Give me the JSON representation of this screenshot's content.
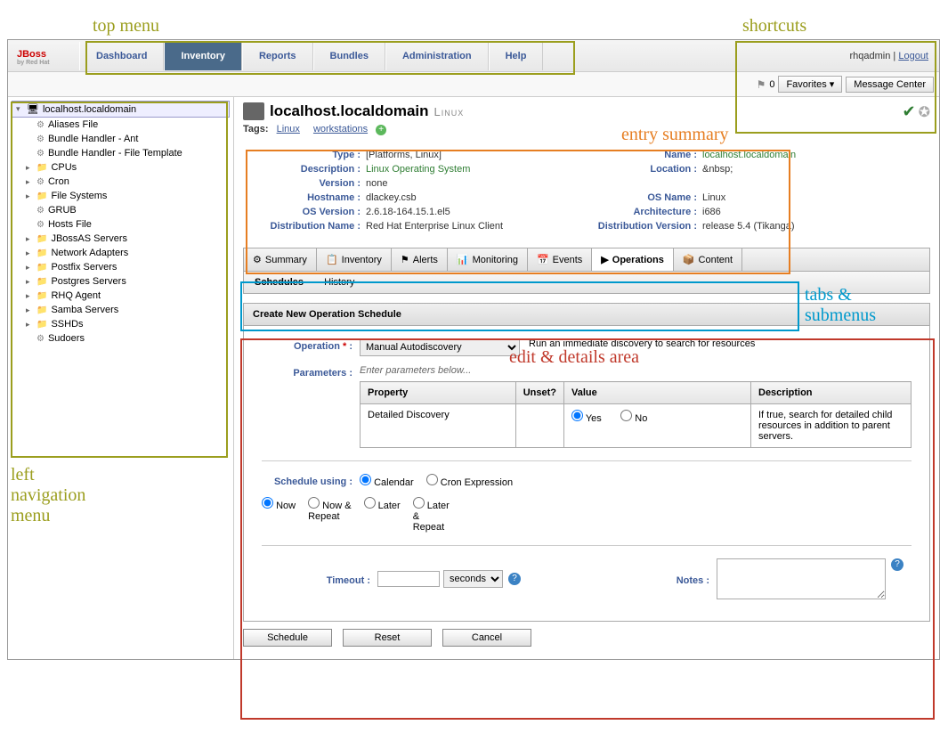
{
  "annotations": {
    "topmenu": "top menu",
    "shortcuts": "shortcuts",
    "leftnav": "left\nnavigation\nmenu",
    "entry": "entry summary",
    "tabs": "tabs &\nsubmenus",
    "edit": "edit & details area"
  },
  "logo": {
    "name": "JBoss",
    "sub": "by Red Hat"
  },
  "topmenu": [
    {
      "label": "Dashboard"
    },
    {
      "label": "Inventory",
      "active": true
    },
    {
      "label": "Reports"
    },
    {
      "label": "Bundles"
    },
    {
      "label": "Administration"
    },
    {
      "label": "Help"
    }
  ],
  "user": {
    "name": "rhqadmin",
    "logout": "Logout"
  },
  "shortcuts": {
    "flagcount": "0",
    "favorites": "Favorites",
    "msgcenter": "Message Center"
  },
  "tree": {
    "root": "localhost.localdomain",
    "items": [
      {
        "icon": "gear",
        "label": "Aliases File"
      },
      {
        "icon": "gear",
        "label": "Bundle Handler - Ant"
      },
      {
        "icon": "gear",
        "label": "Bundle Handler - File Template"
      },
      {
        "icon": "folder",
        "label": "CPUs",
        "expandable": true
      },
      {
        "icon": "gear",
        "label": "Cron",
        "expandable": true
      },
      {
        "icon": "folder",
        "label": "File Systems",
        "expandable": true
      },
      {
        "icon": "gear",
        "label": "GRUB"
      },
      {
        "icon": "gear",
        "label": "Hosts File"
      },
      {
        "icon": "folder",
        "label": "JBossAS Servers",
        "expandable": true
      },
      {
        "icon": "folder",
        "label": "Network Adapters",
        "expandable": true
      },
      {
        "icon": "folder",
        "label": "Postfix Servers",
        "expandable": true
      },
      {
        "icon": "folder",
        "label": "Postgres Servers",
        "expandable": true
      },
      {
        "icon": "folder",
        "label": "RHQ Agent",
        "expandable": true
      },
      {
        "icon": "folder",
        "label": "Samba Servers",
        "expandable": true
      },
      {
        "icon": "folder",
        "label": "SSHDs",
        "expandable": true
      },
      {
        "icon": "gear",
        "label": "Sudoers"
      }
    ]
  },
  "page": {
    "title": "localhost.localdomain",
    "subtitle": "Linux"
  },
  "tags": {
    "label": "Tags:",
    "items": [
      "Linux",
      "workstations"
    ]
  },
  "summary": [
    [
      {
        "label": "Type",
        "value": "[Platforms, Linux]"
      },
      {
        "label": "Name",
        "value": "localhost.localdomain",
        "green": true
      }
    ],
    [
      {
        "label": "Description",
        "value": "Linux Operating System",
        "green": true
      },
      {
        "label": "Location",
        "value": "&nbsp;"
      }
    ],
    [
      {
        "label": "Version",
        "value": "none"
      }
    ],
    [
      {
        "label": "Hostname",
        "value": "dlackey.csb"
      },
      {
        "label": "OS Name",
        "value": "Linux"
      }
    ],
    [
      {
        "label": "OS Version",
        "value": "2.6.18-164.15.1.el5"
      },
      {
        "label": "Architecture",
        "value": "i686"
      }
    ],
    [
      {
        "label": "Distribution Name",
        "value": "Red Hat Enterprise Linux Client"
      },
      {
        "label": "Distribution Version",
        "value": "release 5.4 (Tikanga)"
      }
    ]
  ],
  "tabs": [
    {
      "label": "Summary"
    },
    {
      "label": "Inventory"
    },
    {
      "label": "Alerts"
    },
    {
      "label": "Monitoring"
    },
    {
      "label": "Events"
    },
    {
      "label": "Operations",
      "active": true
    },
    {
      "label": "Content"
    }
  ],
  "submenu": {
    "schedules": "Schedules",
    "history": "History"
  },
  "section": {
    "title": "Create New Operation Schedule"
  },
  "form": {
    "operation_label": "Operation",
    "operation_value": "Manual Autodiscovery",
    "operation_hint": "Run an immediate discovery to search for resources",
    "parameters_label": "Parameters",
    "parameters_hint": "Enter parameters below...",
    "param_headers": {
      "property": "Property",
      "unset": "Unset?",
      "value": "Value",
      "description": "Description"
    },
    "param_row": {
      "property": "Detailed Discovery",
      "yes": "Yes",
      "no": "No",
      "description": "If true, search for detailed child resources in addition to parent servers."
    },
    "schedule_using_label": "Schedule using",
    "schedule_calendar": "Calendar",
    "schedule_cron": "Cron Expression",
    "when": {
      "now": "Now",
      "now_repeat": "Now &\nRepeat",
      "later": "Later",
      "later_repeat": "Later\n&\nRepeat"
    },
    "timeout_label": "Timeout",
    "timeout_unit": "seconds",
    "notes_label": "Notes"
  },
  "buttons": {
    "schedule": "Schedule",
    "reset": "Reset",
    "cancel": "Cancel"
  }
}
